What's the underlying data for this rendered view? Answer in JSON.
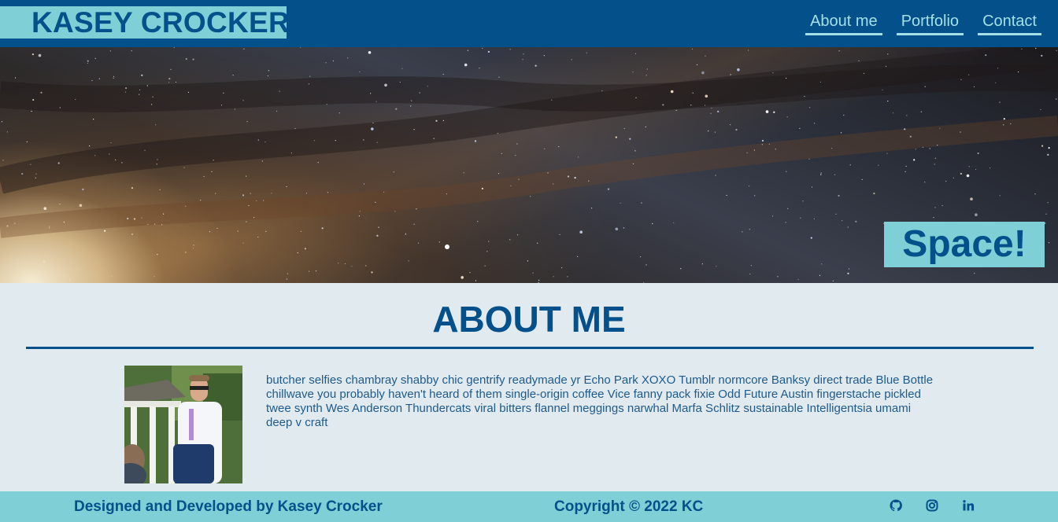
{
  "header": {
    "brand": "KASEY CROCKER",
    "nav": [
      {
        "label": "About me"
      },
      {
        "label": "Portfolio"
      },
      {
        "label": "Contact"
      }
    ]
  },
  "hero": {
    "badge": "Space!"
  },
  "about": {
    "title": "ABOUT ME",
    "bio": "butcher selfies chambray shabby chic gentrify readymade yr Echo Park XOXO Tumblr normcore Banksy direct trade Blue Bottle chillwave you probably haven't heard of them single-origin coffee Vice fanny pack fixie Odd Future Austin fingerstache pickled twee synth Wes Anderson Thundercats viral bitters flannel meggings narwhal Marfa Schlitz sustainable Intelligentsia umami deep v craft"
  },
  "footer": {
    "credit": "Designed and Developed by Kasey Crocker",
    "copyright": "Copyright © 2022 KC",
    "social": [
      {
        "icon": "github-icon"
      },
      {
        "icon": "instagram-icon"
      },
      {
        "icon": "linkedin-icon"
      }
    ]
  },
  "colors": {
    "primary": "#04508a",
    "accent": "#7fcfd7",
    "background": "#e0eaef",
    "nav_link": "#a3e0e6"
  }
}
